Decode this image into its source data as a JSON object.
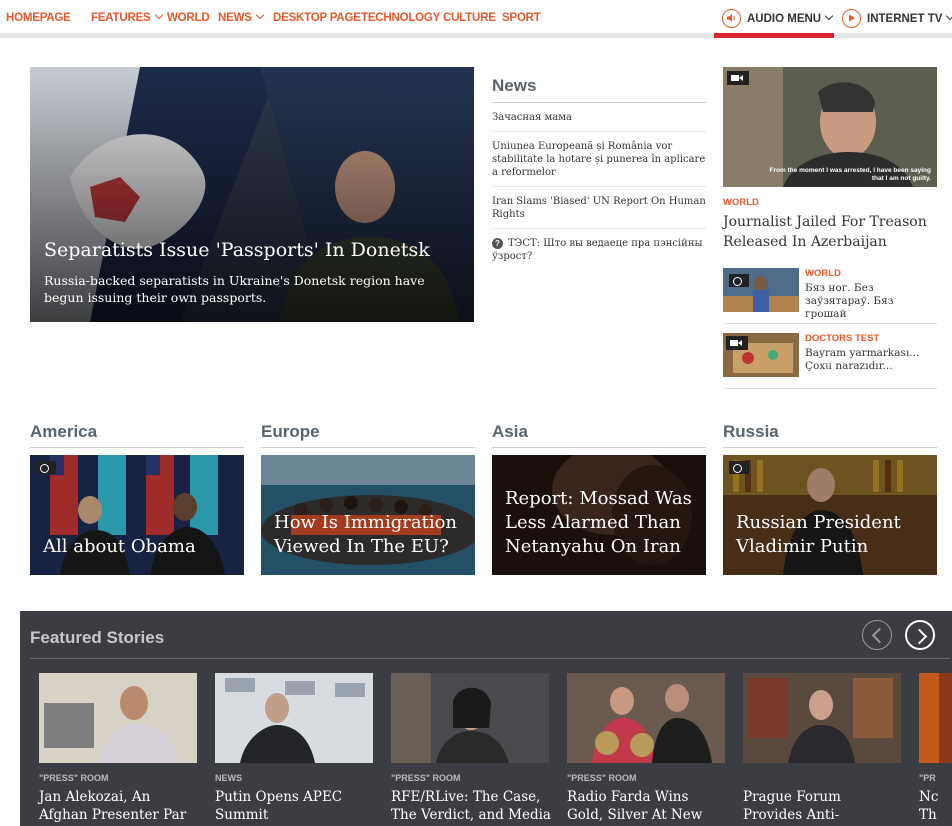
{
  "nav": {
    "items": [
      "HOMEPAGE",
      "FEATURES",
      "WORLD",
      "NEWS",
      "DESKTOP PAGE",
      "TECHNOLOGY",
      "CULTURE",
      "SPORT"
    ],
    "audio_menu": "AUDIO MENU",
    "internet_tv": "INTERNET TV",
    "accent": "#e8592a"
  },
  "hero": {
    "title": "Separatists Issue 'Passports' In Donetsk",
    "description": "Russia-backed separatists in Ukraine's Donetsk region have begun issuing their own passports."
  },
  "news": {
    "heading": "News",
    "items": [
      "Зачасная мама",
      "Uniunea Europeană și România vor stabilitate la hotare și punerea în aplicare a reformelor",
      "Iran Slams 'Biased' UN Report On Human Rights",
      "ТЭСТ: Што вы ведаеце пра пэнсійны ўзрост?"
    ]
  },
  "right": {
    "video_caption": "From the moment I was arrested, I have been saying that I am not guilty.",
    "kicker": "WORLD",
    "title": "Journalist Jailed For Treason Released In Azerbaijan",
    "small": [
      {
        "kicker": "WORLD",
        "title": "Бяз ног. Без заўзятараў. Бяз грошай"
      },
      {
        "kicker": "DOCTORS TEST",
        "title": "Bayram yarmarkası... Çoxu narazıdır..."
      }
    ]
  },
  "sections": [
    {
      "heading": "America",
      "title": "All about Obama"
    },
    {
      "heading": "Europe",
      "title": "How Is Immigration Viewed In The EU?"
    },
    {
      "heading": "Asia",
      "title": "Report: Mossad Was Less Alarmed Than Netanyahu On Iran"
    },
    {
      "heading": "Russia",
      "title": "Russian President Vladimir Putin"
    }
  ],
  "featured": {
    "heading": "Featured Stories",
    "cards": [
      {
        "kicker": "\"PRESS\" ROOM",
        "title": "Jan Alekozai, An Afghan Presenter Par"
      },
      {
        "kicker": "NEWS",
        "title": "Putin Opens APEC Summit"
      },
      {
        "kicker": "\"PRESS\" ROOM",
        "title": "RFE/RLive: The Case, The Verdict, and Media"
      },
      {
        "kicker": "\"PRESS\" ROOM",
        "title": "Radio Farda Wins Gold, Silver At New York"
      },
      {
        "kicker": "",
        "title": "Prague Forum Provides Anti-Corruption Platform"
      },
      {
        "kicker": "\"PR",
        "title": "Nc Th"
      }
    ]
  }
}
